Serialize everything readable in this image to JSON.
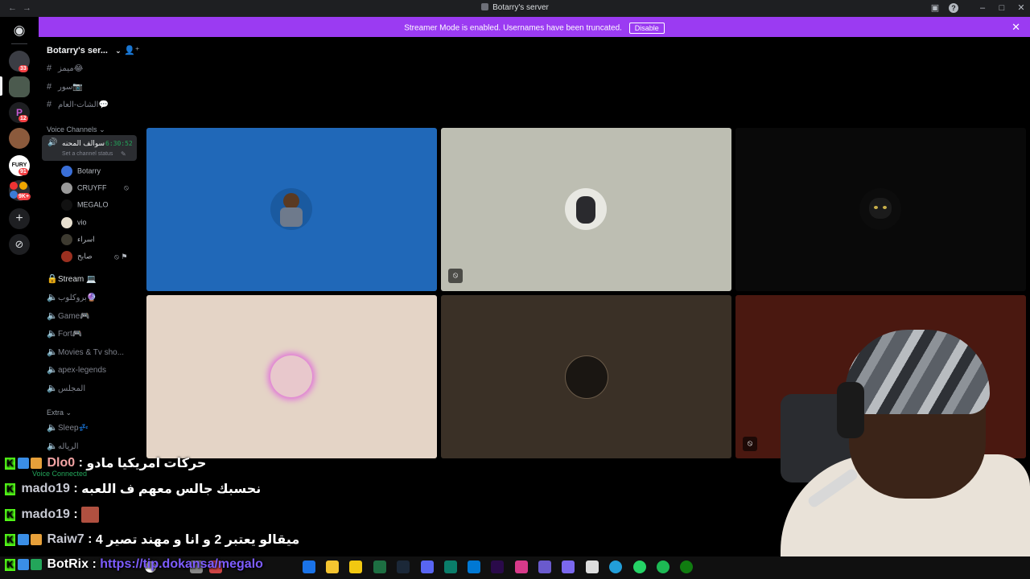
{
  "window": {
    "title": "Botarry's server",
    "back": "←",
    "forward": "→"
  },
  "banner": {
    "text": "Streamer Mode is enabled. Usernames have been truncated.",
    "button": "Disable",
    "close": "✕"
  },
  "guilds": {
    "badges": [
      "33",
      "12",
      "91",
      "9K+"
    ]
  },
  "sidebar": {
    "server_name": "Botarry's ser...",
    "text_channels": [
      "ميمز😂",
      "سور📷",
      "الشات-العام💬"
    ],
    "voice_category": "Voice Channels",
    "active_voice": {
      "name": "سوالف المحنه",
      "timer": "6:30:52",
      "status": "Set a channel status"
    },
    "users": [
      "Botarry",
      "CRUYFF",
      "MEGALO",
      "vio",
      "اسراء",
      "صابح"
    ],
    "voice_channels": [
      "Stream 💻",
      "بروكلوب🔮",
      "Game🎮",
      "Fort🎮",
      "Movies & Tv sho...",
      "apex-legends",
      "المجلس"
    ],
    "extra_category": "Extra",
    "extra_channels": [
      "Sleep💤",
      "الرياله"
    ],
    "voice_connected": "Voice Connected"
  },
  "chat": [
    {
      "user": "Dlo0",
      "sep": " : ",
      "message": "حركات امريكيا مادو",
      "user_color": "#f3a4a4"
    },
    {
      "user": "mado19",
      "sep": " : ",
      "message": "نحسبك جالس معهم ف اللعبه",
      "user_color": "#c7c9d3"
    },
    {
      "user": "mado19",
      "sep": " : ",
      "message": "",
      "user_color": "#c7c9d3"
    },
    {
      "user": "Raiw7",
      "sep": " : ",
      "message": "ميقالو يعتبر 2 و انا و مهند تصير 4",
      "user_color": "#c7c9d3"
    },
    {
      "user": "BotRix",
      "sep": " : ",
      "message": "https://tip.dokansa/megalo",
      "user_color": "#ffffff"
    }
  ],
  "colors": {
    "accent": "#9b3bf2",
    "tile_blue": "#2068b8",
    "tile_grey": "#bdbeb2",
    "tile_peach": "#e4d4c6",
    "tile_brown": "#3a3026",
    "tile_red": "#4a1810"
  }
}
